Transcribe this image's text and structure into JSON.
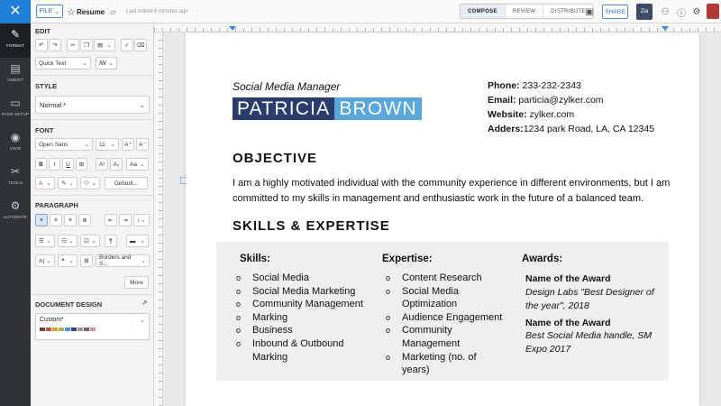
{
  "topbar": {
    "file_label": "FILE",
    "doc_name": "Resume",
    "edited": "Last edited 6 minutes ago",
    "tabs": [
      "COMPOSE",
      "REVIEW",
      "DISTRIBUTE"
    ],
    "share_label": "SHARE",
    "zia_label": "Zia"
  },
  "rail": {
    "items": [
      "FORMAT",
      "INSERT",
      "PAGE SETUP",
      "VIEW",
      "TOOLS",
      "AUTOMATE"
    ]
  },
  "panel": {
    "edit_title": "EDIT",
    "quick_text": "Quick Text",
    "style_title": "STYLE",
    "style_value": "Normal *",
    "font_title": "FONT",
    "font_family": "Open Sans",
    "font_size": "11",
    "default_label": "Default...",
    "paragraph_title": "PARAGRAPH",
    "borders_label": "Borders and S...",
    "more_label": "More",
    "design_title": "DOCUMENT DESIGN",
    "design_value": "Custom*"
  },
  "colors": {
    "accent": "#1f7fd8",
    "name_first_bg": "#2a3d6c",
    "name_last_bg": "#5aa7dd",
    "swatches": [
      "#7a3b3b",
      "#c44d4d",
      "#e0a030",
      "#9fb85a",
      "#4a8fd6",
      "#3a3f80",
      "#999999",
      "#666666",
      "#cc9999"
    ]
  },
  "resume": {
    "job_title": "Social Media Manager",
    "first_name": "PATRICIA",
    "last_name": "BROWN",
    "contact": [
      {
        "label": "Phone:",
        "value": " 233-232-2343"
      },
      {
        "label": "Email:",
        "value": " parti­cia@zylker.com"
      },
      {
        "label": "Website:",
        "value": " zylker.com"
      },
      {
        "label": "Adders:",
        "value": "1234 park Road, LA, CA 12345"
      }
    ],
    "objective_heading": "OBJECTIVE",
    "objective_text": "I am a highly motivated individual with the community experience in different environments, but I am committed to my skills in management and enthusiastic work in the future of a balanced team.",
    "skills_heading": "SKILLS & EXPERTISE",
    "skills_label": "Skills:",
    "skills": [
      "Social Media",
      "Social Media Marketing",
      "Community Management",
      "Marking",
      "Business",
      "Inbound & Outbound Marking"
    ],
    "expertise_label": "Expertise:",
    "expertise": [
      "Content Research",
      "Social Media Optimization",
      "Audience Engagement",
      "Community Management",
      "Marketing (no. of years)"
    ],
    "awards_label": "Awards:",
    "awards": [
      {
        "title": "Name of the Award",
        "desc": "Design Labs \"Best Designer of the year\", 2018"
      },
      {
        "title": "Name of the Award",
        "desc": "Best Social Media handle, SM Expo 2017"
      }
    ]
  }
}
